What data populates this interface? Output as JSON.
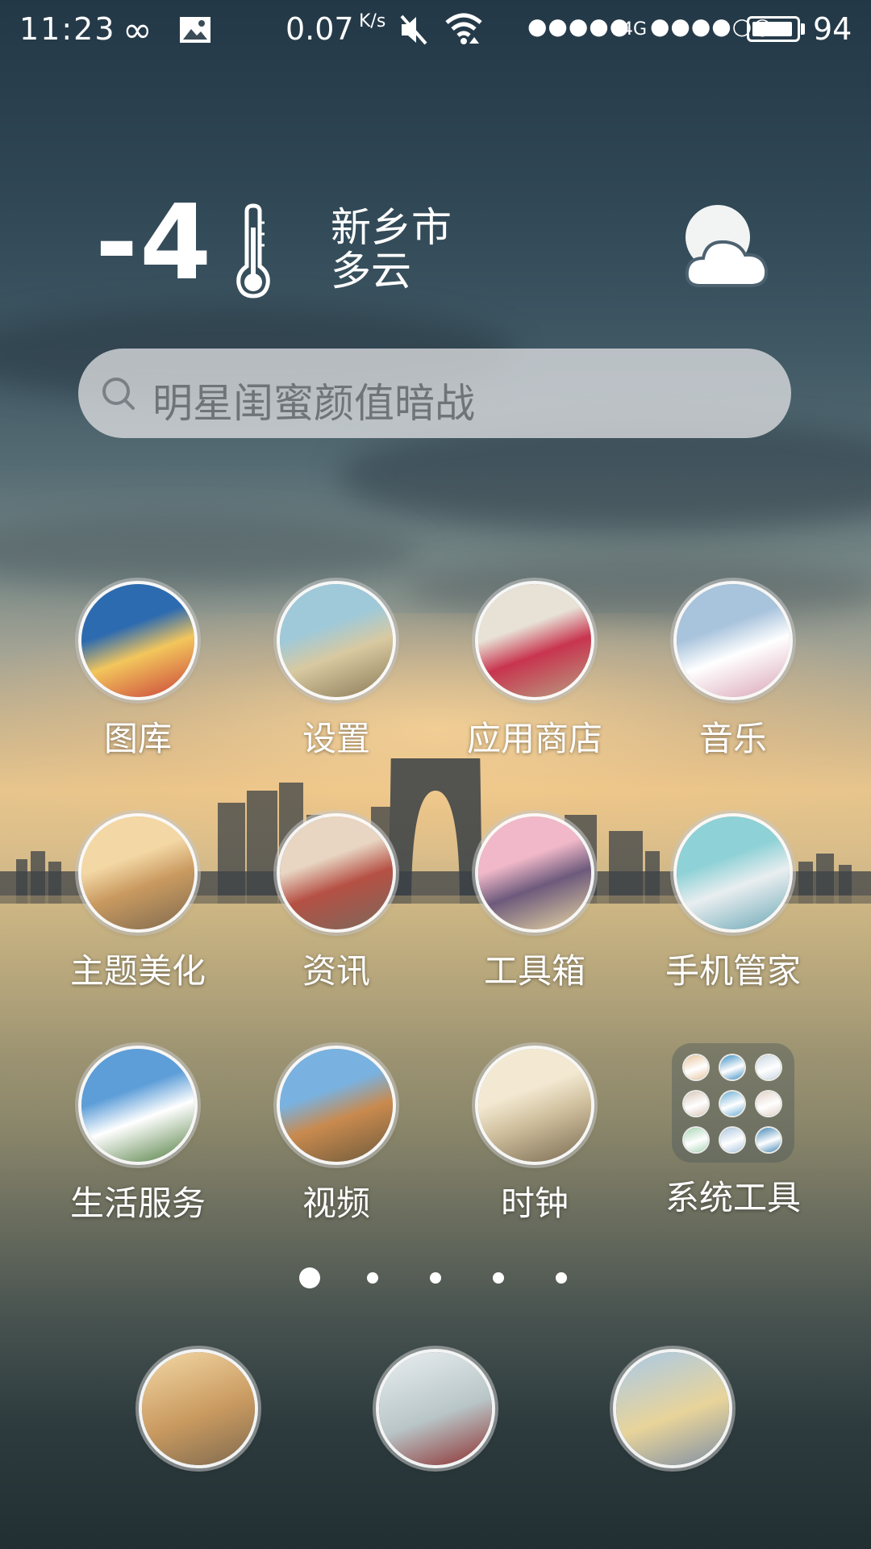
{
  "status_bar": {
    "time": "11:23",
    "loop_icon": "infinity-icon",
    "image_icon": "picture-icon",
    "net_speed": "0.07",
    "net_speed_unit": "K/s",
    "mute_icon": "mute-icon",
    "wifi_icon": "wifi-icon",
    "sim1_signal": "●●●●●",
    "network_type": "4G",
    "sim2_signal": "●●●●○○",
    "battery_level": "94",
    "battery_fraction": 0.94
  },
  "weather": {
    "temperature": "-4",
    "city": "新乡市",
    "condition": "多云",
    "thermometer_icon": "thermometer-icon",
    "condition_icon": "partly-cloudy-icon"
  },
  "search": {
    "placeholder": "明星闺蜜颜值暗战",
    "icon": "search-icon"
  },
  "apps": [
    {
      "label": "图库",
      "icon": "gallery-icon",
      "colors": [
        "#2d6bb0",
        "#f3c65c",
        "#c9413a"
      ]
    },
    {
      "label": "设置",
      "icon": "settings-icon",
      "colors": [
        "#9fc9d9",
        "#d8c9a0",
        "#8a7a58"
      ]
    },
    {
      "label": "应用商店",
      "icon": "app-store-icon",
      "colors": [
        "#e8e2d6",
        "#c8344e",
        "#b89f82"
      ]
    },
    {
      "label": "音乐",
      "icon": "music-icon",
      "colors": [
        "#a8c3dc",
        "#ffffff",
        "#d9a3b5"
      ]
    },
    {
      "label": "主题美化",
      "icon": "theme-icon",
      "colors": [
        "#f3d7a4",
        "#c99a60",
        "#7f6a4f"
      ]
    },
    {
      "label": "资讯",
      "icon": "news-icon",
      "colors": [
        "#e8d5c2",
        "#b55044",
        "#7a6a5c"
      ]
    },
    {
      "label": "工具箱",
      "icon": "toolbox-icon",
      "colors": [
        "#f0b8c8",
        "#6d5a7c",
        "#e9d7a4"
      ]
    },
    {
      "label": "手机管家",
      "icon": "phone-manager-icon",
      "colors": [
        "#8ed1d6",
        "#e9eef0",
        "#6aa7b5"
      ]
    },
    {
      "label": "生活服务",
      "icon": "life-service-icon",
      "colors": [
        "#5d9ed8",
        "#ffffff",
        "#4c7a3a"
      ]
    },
    {
      "label": "视频",
      "icon": "video-icon",
      "colors": [
        "#79b2e0",
        "#c98a4e",
        "#6d5a3c"
      ]
    },
    {
      "label": "时钟",
      "icon": "clock-icon",
      "colors": [
        "#f3e9d2",
        "#cfbf9d",
        "#7a6a52"
      ]
    }
  ],
  "folder": {
    "label": "系统工具",
    "mini_colors": [
      "#e7c49a",
      "#3d8fc4",
      "#c9d6e0",
      "#d9c7b8",
      "#6aaed6",
      "#e2d2c8",
      "#a9d6b6",
      "#aac6e0",
      "#3f86b5"
    ]
  },
  "page_indicator": {
    "total": 5,
    "active": 1
  },
  "dock": [
    {
      "icon": "dock-city-icon",
      "colors": [
        "#f3d7a4",
        "#c99a60",
        "#7f6a4f"
      ]
    },
    {
      "icon": "dock-building-icon",
      "colors": [
        "#e8eef0",
        "#b9c6c8",
        "#8d2f2f"
      ]
    },
    {
      "icon": "dock-bridge-icon",
      "colors": [
        "#a9c9e8",
        "#e8d49a",
        "#7f8fa4"
      ]
    }
  ]
}
